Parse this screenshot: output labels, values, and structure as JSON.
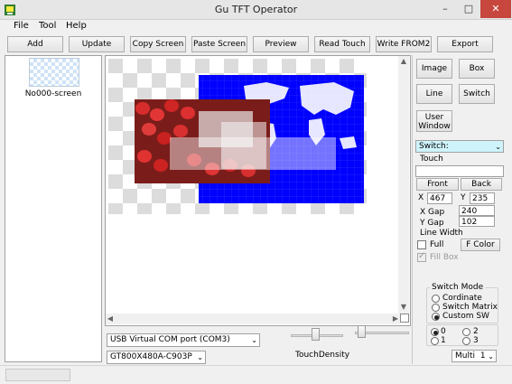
{
  "window": {
    "title": "Gu TFT Operator",
    "minimize": "–",
    "maximize": "□",
    "close": "✕"
  },
  "menu": [
    "File",
    "Tool",
    "Help"
  ],
  "toolbar": [
    "Add",
    "Update",
    "Copy Screen",
    "Paste Screen",
    "Preview",
    "Read Touch",
    "Write FROM2",
    "Export"
  ],
  "screens": [
    {
      "label": "No000-screen"
    }
  ],
  "shape_buttons": [
    "Image",
    "Box",
    "Line",
    "Switch",
    "User\nWindow"
  ],
  "switch_select": {
    "value": "Switch:",
    "bg": "#cef3fb"
  },
  "touch": {
    "label": "Touch",
    "value": ""
  },
  "front_label": "Front",
  "back_label": "Back",
  "coords": {
    "x_label": "X",
    "x": "467",
    "y_label": "Y",
    "y": "235"
  },
  "gap": {
    "xgap_label": "X Gap",
    "xgap": "240",
    "ygap_label": "Y Gap",
    "ygap": "102",
    "linewidth_label": "Line Width"
  },
  "full_label": "Full",
  "fcolor_label": "F Color",
  "fillbox_label": "Fill Box",
  "switch_mode": {
    "title": "Switch Mode",
    "options": [
      "Cordinate",
      "Switch Matrix",
      "Custom SW"
    ],
    "selected": 2
  },
  "channel": {
    "options": [
      "0",
      "2",
      "1",
      "3"
    ],
    "selected": 0
  },
  "multi": {
    "value": "Multi",
    "count": "1"
  },
  "port": {
    "value": "USB Virtual COM port (COM3)"
  },
  "device": {
    "value": "GT800X480A-C903P"
  },
  "touch_density_label": "TouchDensity",
  "colors": {
    "canvas_blue": "#0000ff",
    "checker": "#dcdcdc"
  }
}
